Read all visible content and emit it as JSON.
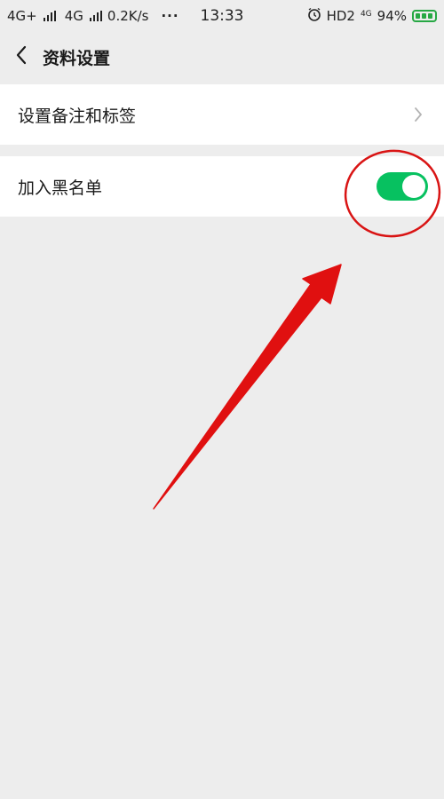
{
  "status_bar": {
    "net1": "4G+",
    "net2": "4G",
    "speed": "0.2K/s",
    "dots": "···",
    "time": "13:33",
    "hd": "HD2",
    "net3": "4G",
    "battery": "94%"
  },
  "header": {
    "title": "资料设置"
  },
  "settings": {
    "remark_label": "设置备注和标签",
    "blacklist_label": "加入黑名单",
    "blacklist_enabled": true
  },
  "colors": {
    "toggle_on": "#07c160",
    "annotation": "#e01010",
    "background": "#ededed"
  }
}
